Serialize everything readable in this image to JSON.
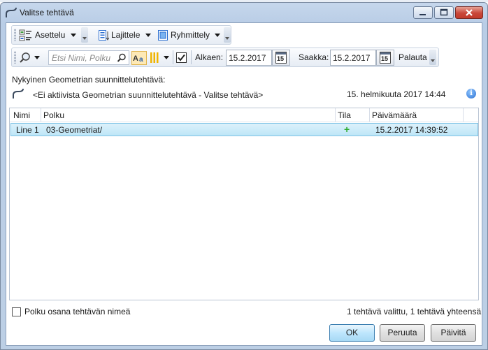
{
  "window": {
    "title": "Valitse tehtävä"
  },
  "toolbar1": {
    "layout_label": "Asettelu",
    "sort_label": "Lajittele",
    "group_label": "Ryhmittely"
  },
  "toolbar2": {
    "search_placeholder": "Etsi Nimi, Polku",
    "from_label": "Alkaen:",
    "from_value": "15.2.2017",
    "to_label": "Saakka:",
    "to_value": "15.2.2017",
    "calendar_day": "15",
    "reset_label": "Palauta",
    "filter_checked": true
  },
  "current": {
    "heading": "Nykyinen Geometrian suunnittelutehtävä:",
    "value": "<Ei aktiivista Geometrian suunnittelutehtävä - Valitse tehtävä>",
    "timestamp": "15. helmikuuta 2017 14:44"
  },
  "grid": {
    "columns": [
      "Nimi",
      "Polku",
      "Tila",
      "Päivämäärä"
    ],
    "rows": [
      {
        "name": "Line 1",
        "path": "03-Geometriat/",
        "status": "+",
        "date": "15.2.2017 14:39:52"
      }
    ]
  },
  "footer": {
    "checkbox_label": "Polku osana tehtävän nimeä",
    "status": "1 tehtävä valittu, 1 tehtävä yhteensä",
    "ok_label": "OK",
    "cancel_label": "Peruuta",
    "refresh_label": "Päivitä"
  },
  "colors": {
    "selection": "#bee6f7",
    "title_bg": "#c6d7ec",
    "status_add": "#2eab2e",
    "ok_border": "#3c7fb1"
  }
}
